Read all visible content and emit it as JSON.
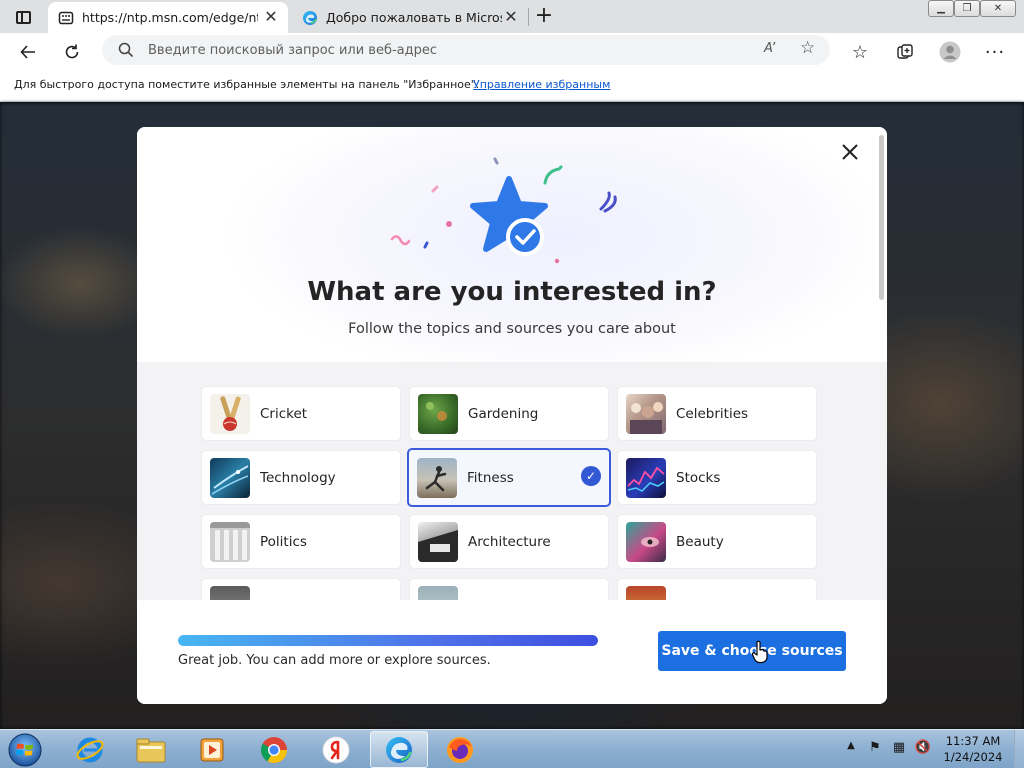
{
  "browser": {
    "tabs": [
      {
        "title": "https://ntp.msn.com/edge/ntp?&",
        "icon": "page-icon"
      },
      {
        "title": "Добро пожаловать в Microsoft",
        "icon": "edge-icon"
      }
    ],
    "address_bar": {
      "placeholder": "Введите поисковый запрос или веб-адрес",
      "read_aloud_label": "A’"
    },
    "favorites_hint": {
      "text": "Для быстрого доступа поместите избранные элементы на панель \"Избранное\".",
      "link": "Управление избранным"
    }
  },
  "modal": {
    "title": "What are you interested in?",
    "subtitle": "Follow the topics and sources you care about",
    "topics": [
      {
        "label": "Cricket",
        "selected": false
      },
      {
        "label": "Gardening",
        "selected": false
      },
      {
        "label": "Celebrities",
        "selected": false
      },
      {
        "label": "Technology",
        "selected": false
      },
      {
        "label": "Fitness",
        "selected": true
      },
      {
        "label": "Stocks",
        "selected": false
      },
      {
        "label": "Politics",
        "selected": false
      },
      {
        "label": "Architecture",
        "selected": false
      },
      {
        "label": "Beauty",
        "selected": false
      }
    ],
    "progress": 1.0,
    "footer_message": "Great job. You can add more or explore sources.",
    "save_button": "Save & choose sources"
  },
  "taskbar": {
    "apps": [
      "internet-explorer-icon",
      "file-explorer-icon",
      "media-player-icon",
      "chrome-icon",
      "yandex-icon",
      "edge-icon",
      "firefox-icon"
    ],
    "active_app": "edge-icon",
    "clock": {
      "time": "11:37 AM",
      "date": "1/24/2024"
    }
  },
  "colors": {
    "accent": "#1b6fe0",
    "selected_border": "#3b5bdb",
    "star": "#2f78e8"
  }
}
